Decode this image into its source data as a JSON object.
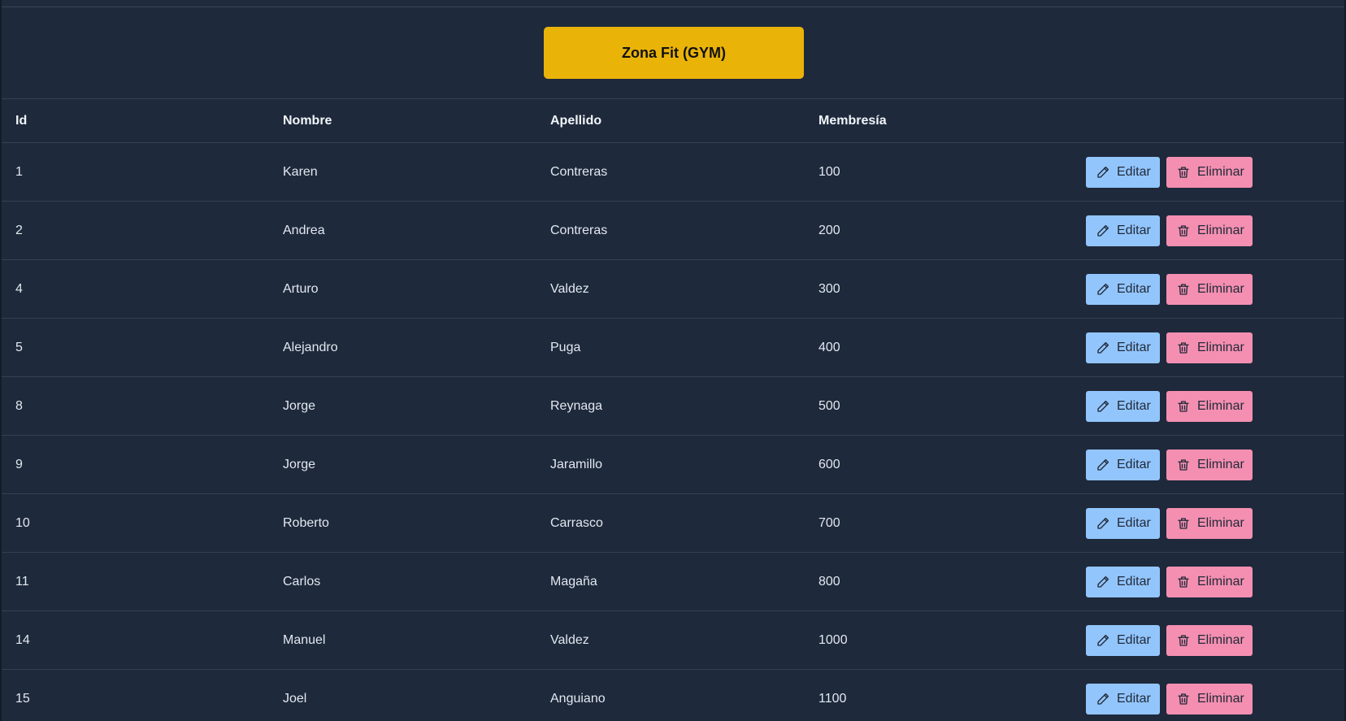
{
  "title": "Zona Fit (GYM)",
  "table": {
    "headers": {
      "id": "Id",
      "nombre": "Nombre",
      "apellido": "Apellido",
      "membresia": "Membresía"
    },
    "actions": {
      "edit_label": "Editar",
      "delete_label": "Eliminar",
      "edit_icon": "pencil-icon",
      "delete_icon": "trash-icon"
    },
    "rows": [
      {
        "id": "1",
        "nombre": "Karen",
        "apellido": "Contreras",
        "membresia": "100"
      },
      {
        "id": "2",
        "nombre": "Andrea",
        "apellido": "Contreras",
        "membresia": "200"
      },
      {
        "id": "4",
        "nombre": "Arturo",
        "apellido": "Valdez",
        "membresia": "300"
      },
      {
        "id": "5",
        "nombre": "Alejandro",
        "apellido": "Puga",
        "membresia": "400"
      },
      {
        "id": "8",
        "nombre": "Jorge",
        "apellido": "Reynaga",
        "membresia": "500"
      },
      {
        "id": "9",
        "nombre": "Jorge",
        "apellido": "Jaramillo",
        "membresia": "600"
      },
      {
        "id": "10",
        "nombre": "Roberto",
        "apellido": "Carrasco",
        "membresia": "700"
      },
      {
        "id": "11",
        "nombre": "Carlos",
        "apellido": "Magaña",
        "membresia": "800"
      },
      {
        "id": "14",
        "nombre": "Manuel",
        "apellido": "Valdez",
        "membresia": "1000"
      },
      {
        "id": "15",
        "nombre": "Joel",
        "apellido": "Anguiano",
        "membresia": "1100"
      }
    ]
  },
  "colors": {
    "background": "#1e293b",
    "banner": "#eab308",
    "edit_button": "#93c5fd",
    "delete_button": "#f48fb1",
    "row_border": "#334155"
  }
}
